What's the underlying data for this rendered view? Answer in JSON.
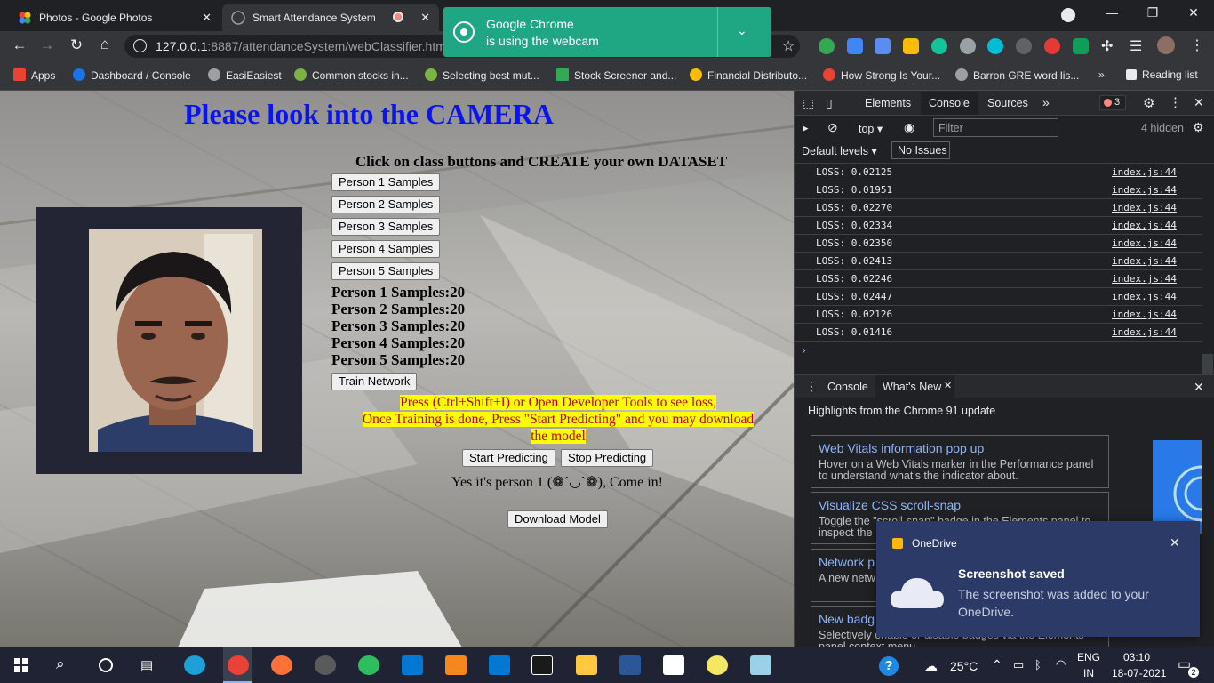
{
  "browser": {
    "tabs": [
      {
        "title": "Photos - Google Photos",
        "icon": "google-photos-icon"
      },
      {
        "title": "Smart Attendance System",
        "icon": "globe-icon",
        "recording_indicator": true
      }
    ],
    "url": {
      "host": "127.0.0.1",
      "rest": ":8887/attendanceSystem/webClassifier.html"
    },
    "bookmarks": [
      {
        "label": "Apps",
        "color": "#ea4335"
      },
      {
        "label": "Dashboard / Console",
        "color": "#1a73e8"
      },
      {
        "label": "EasiEasiest",
        "color": "#9aa0a6"
      },
      {
        "label": "Common stocks in...",
        "color": "#7cb342"
      },
      {
        "label": "Selecting best mut...",
        "color": "#7cb342"
      },
      {
        "label": "Stock Screener and...",
        "color": "#34a853"
      },
      {
        "label": "Financial Distributo...",
        "color": "#fbbc04"
      },
      {
        "label": "How Strong Is Your...",
        "color": "#ea4335"
      },
      {
        "label": "Barron GRE word lis...",
        "color": "#9aa0a6"
      }
    ],
    "more_bookmarks": "»",
    "reading_list": "Reading list",
    "webcam_popup": {
      "line1": "Google Chrome",
      "line2": "is using the webcam"
    }
  },
  "app": {
    "heading": "Please look into the CAMERA",
    "instruction": "Click on class buttons and CREATE your own DATASET",
    "sample_buttons": [
      "Person 1 Samples",
      "Person 2 Samples",
      "Person 3 Samples",
      "Person 4 Samples",
      "Person 5 Samples"
    ],
    "sample_counts": [
      "Person 1 Samples:20",
      "Person 2 Samples:20",
      "Person 3 Samples:20",
      "Person 4 Samples:20",
      "Person 5 Samples:20"
    ],
    "train_button": "Train Network",
    "note_line1": "Press (Ctrl+Shift+I) or Open Developer Tools to see loss,",
    "note_line2": "Once Training is done, Press \"Start Predicting\" and you may download",
    "note_line3": "the model",
    "start_button": "Start Predicting",
    "stop_button": "Stop Predicting",
    "prediction": "Yes it's person 1 (❁´◡`❁), Come in!",
    "download_button": "Download Model"
  },
  "devtools": {
    "tabs": [
      "Elements",
      "Console",
      "Sources"
    ],
    "active_tab": "Console",
    "error_count": "3",
    "context": "top",
    "filter_placeholder": "Filter",
    "hidden_count": "4 hidden",
    "levels": "Default levels",
    "issues": "No Issues",
    "logs": [
      {
        "msg": "LOSS: 0.02125",
        "src": "index.js:44"
      },
      {
        "msg": "LOSS: 0.01951",
        "src": "index.js:44"
      },
      {
        "msg": "LOSS: 0.02270",
        "src": "index.js:44"
      },
      {
        "msg": "LOSS: 0.02334",
        "src": "index.js:44"
      },
      {
        "msg": "LOSS: 0.02350",
        "src": "index.js:44"
      },
      {
        "msg": "LOSS: 0.02413",
        "src": "index.js:44"
      },
      {
        "msg": "LOSS: 0.02246",
        "src": "index.js:44"
      },
      {
        "msg": "LOSS: 0.02447",
        "src": "index.js:44"
      },
      {
        "msg": "LOSS: 0.02126",
        "src": "index.js:44"
      },
      {
        "msg": "LOSS: 0.01416",
        "src": "index.js:44"
      }
    ],
    "prompt": "›",
    "drawer_tabs": [
      "Console",
      "What's New"
    ],
    "whats_new_heading": "Highlights from the Chrome 91 update",
    "cards": [
      {
        "title": "Web Vitals information pop up",
        "desc": "Hover on a Web Vitals marker in the Performance panel to understand what's the indicator about."
      },
      {
        "title": "Visualize CSS scroll-snap",
        "desc": "Toggle the \"scroll-snap\" badge in the Elements panel to inspect the"
      },
      {
        "title": "Network p",
        "desc": "A new netw configure"
      },
      {
        "title": "New badg",
        "desc": "Selectively enable or disable badges via the Elements panel context menu."
      }
    ]
  },
  "toast": {
    "app": "OneDrive",
    "title": "Screenshot saved",
    "message": "The screenshot was added to your OneDrive."
  },
  "taskbar": {
    "temperature": "25°C",
    "language": "ENG",
    "region": "IN",
    "time": "03:10",
    "date": "18-07-2021",
    "notification_count": "2"
  }
}
